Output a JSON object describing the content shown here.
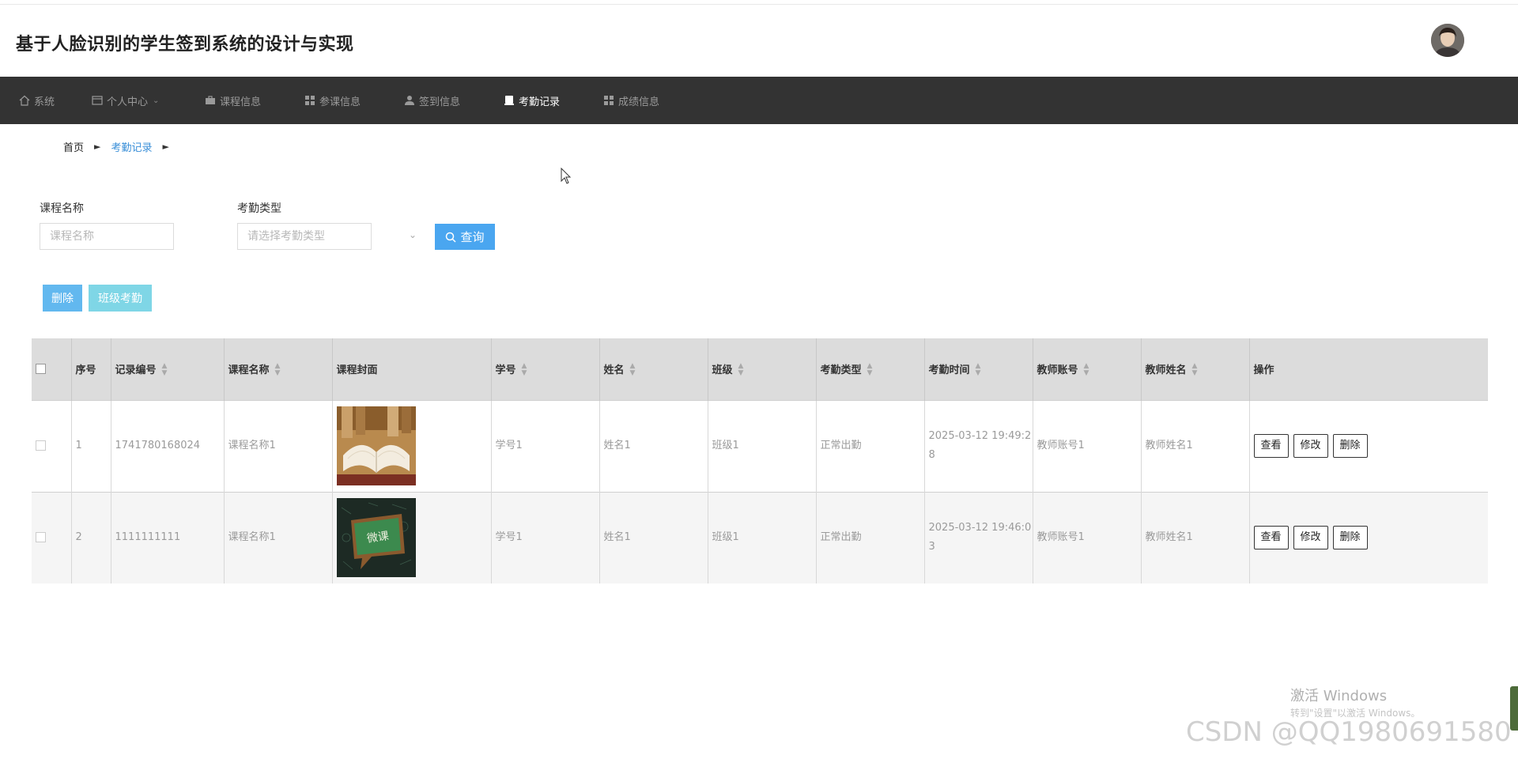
{
  "header": {
    "title": "基于人脸识别的学生签到系统的设计与实现"
  },
  "nav": {
    "items": [
      {
        "label": "系统",
        "icon": "home-icon"
      },
      {
        "label": "个人中心",
        "icon": "window-icon"
      },
      {
        "label": "课程信息",
        "icon": "briefcase-icon"
      },
      {
        "label": "参课信息",
        "icon": "grid-icon"
      },
      {
        "label": "签到信息",
        "icon": "user-icon"
      },
      {
        "label": "考勤记录",
        "icon": "tablet-icon",
        "active": true
      },
      {
        "label": "成绩信息",
        "icon": "grid-icon"
      }
    ]
  },
  "breadcrumb": {
    "home": "首页",
    "current": "考勤记录"
  },
  "filters": {
    "course_label": "课程名称",
    "course_placeholder": "课程名称",
    "type_label": "考勤类型",
    "type_placeholder": "请选择考勤类型",
    "query_label": "查询"
  },
  "actions": {
    "delete_label": "删除",
    "class_attendance_label": "班级考勤"
  },
  "table": {
    "headers": {
      "index": "序号",
      "record_no": "记录编号",
      "course_name": "课程名称",
      "cover": "课程封面",
      "student_no": "学号",
      "name": "姓名",
      "class": "班级",
      "attendance_type": "考勤类型",
      "attendance_time": "考勤时间",
      "teacher_account": "教师账号",
      "teacher_name": "教师姓名",
      "ops": "操作"
    },
    "rows": [
      {
        "index": "1",
        "record_no": "1741780168024",
        "course_name": "课程名称1",
        "cover": "open-book-image",
        "student_no": "学号1",
        "name": "姓名1",
        "class": "班级1",
        "attendance_type": "正常出勤",
        "attendance_time": "2025-03-12 19:49:28",
        "teacher_account": "教师账号1",
        "teacher_name": "教师姓名1"
      },
      {
        "index": "2",
        "record_no": "1111111111",
        "course_name": "课程名称1",
        "cover": "chalkboard-image",
        "cover_text": "微课",
        "student_no": "学号1",
        "name": "姓名1",
        "class": "班级1",
        "attendance_type": "正常出勤",
        "attendance_time": "2025-03-12 19:46:03",
        "teacher_account": "教师账号1",
        "teacher_name": "教师姓名1"
      }
    ],
    "op_labels": {
      "view": "查看",
      "edit": "修改",
      "delete": "删除"
    }
  },
  "watermarks": {
    "windows_title": "激活 Windows",
    "windows_sub": "转到\"设置\"以激活 Windows。",
    "csdn": "CSDN @QQ1980691580"
  },
  "colors": {
    "nav_bg": "#333333",
    "primary": "#4aa6f0",
    "delete_btn": "#62b8ef",
    "class_btn": "#7fd6e6",
    "breadcrumb_active": "#3a8fd8"
  }
}
